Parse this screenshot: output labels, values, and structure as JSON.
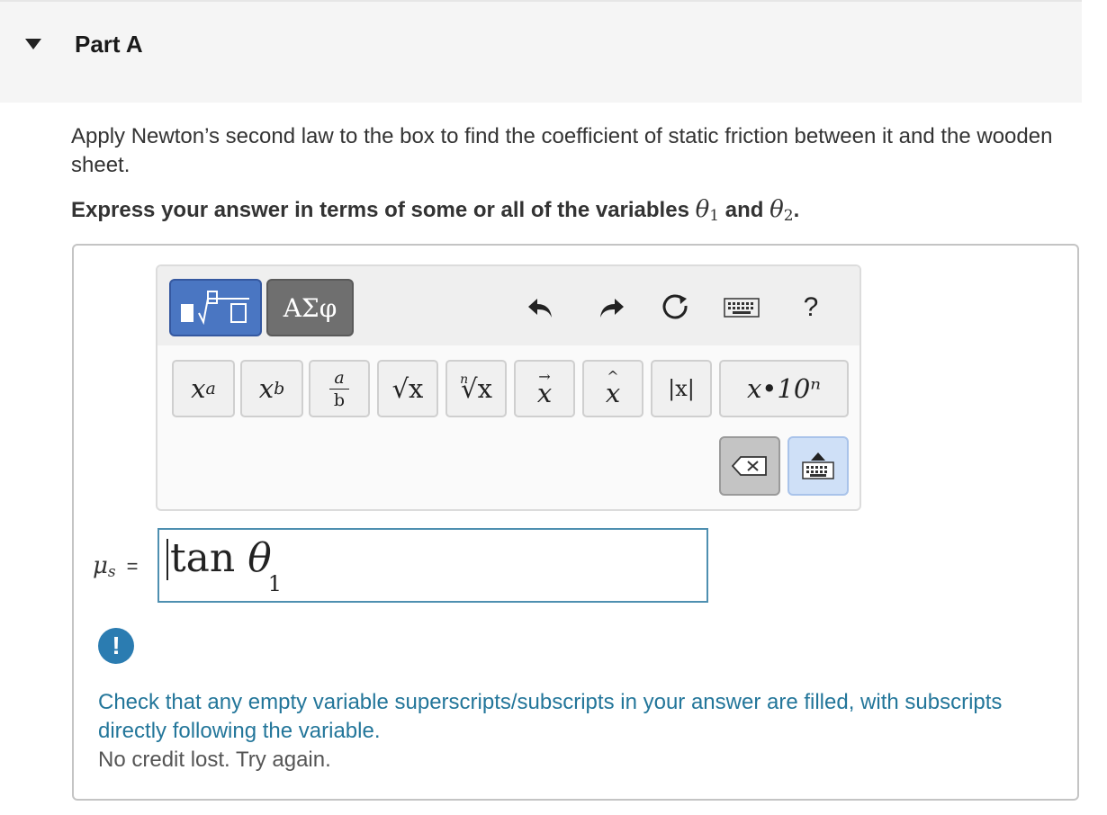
{
  "part": {
    "title": "Part A"
  },
  "question": {
    "prompt": "Apply Newton’s second law to the box to find the coefficient of static friction between it and the wooden sheet.",
    "instruction_prefix": "Express your answer in terms of some or all of the variables",
    "var1": "θ",
    "var1_sub": "1",
    "conj": "and",
    "var2": "θ",
    "var2_sub": "2",
    "period": "."
  },
  "toolbar": {
    "templates_label": "templates",
    "greek_label": "ΑΣφ",
    "help_label": "?",
    "icons": [
      "undo-icon",
      "redo-icon",
      "reset-icon",
      "keyboard-icon",
      "help-icon"
    ],
    "buttons": {
      "superscript": {
        "base": "x",
        "exp": "a"
      },
      "subscript": {
        "base": "x",
        "sub": "b"
      },
      "fraction": {
        "num": "a",
        "den": "b"
      },
      "sqrt": "√x",
      "nroot": {
        "index": "n",
        "body": "√x"
      },
      "vector": "x",
      "unitvector": "x",
      "abs": "|x|",
      "scinot": "x•10ⁿ"
    }
  },
  "answer": {
    "label_var": "μ",
    "label_sub": "s",
    "equals": "=",
    "value_func": "tan",
    "value_var": "θ",
    "value_sub": "1"
  },
  "feedback": {
    "icon": "!",
    "message": "Check that any empty variable superscripts/subscripts in your answer are filled, with subscripts directly following the variable.",
    "credit": "No credit lost. Try again."
  },
  "colors": {
    "accent": "#4a76c2",
    "feedback": "#23769a",
    "input_border": "#4e8fb0"
  }
}
